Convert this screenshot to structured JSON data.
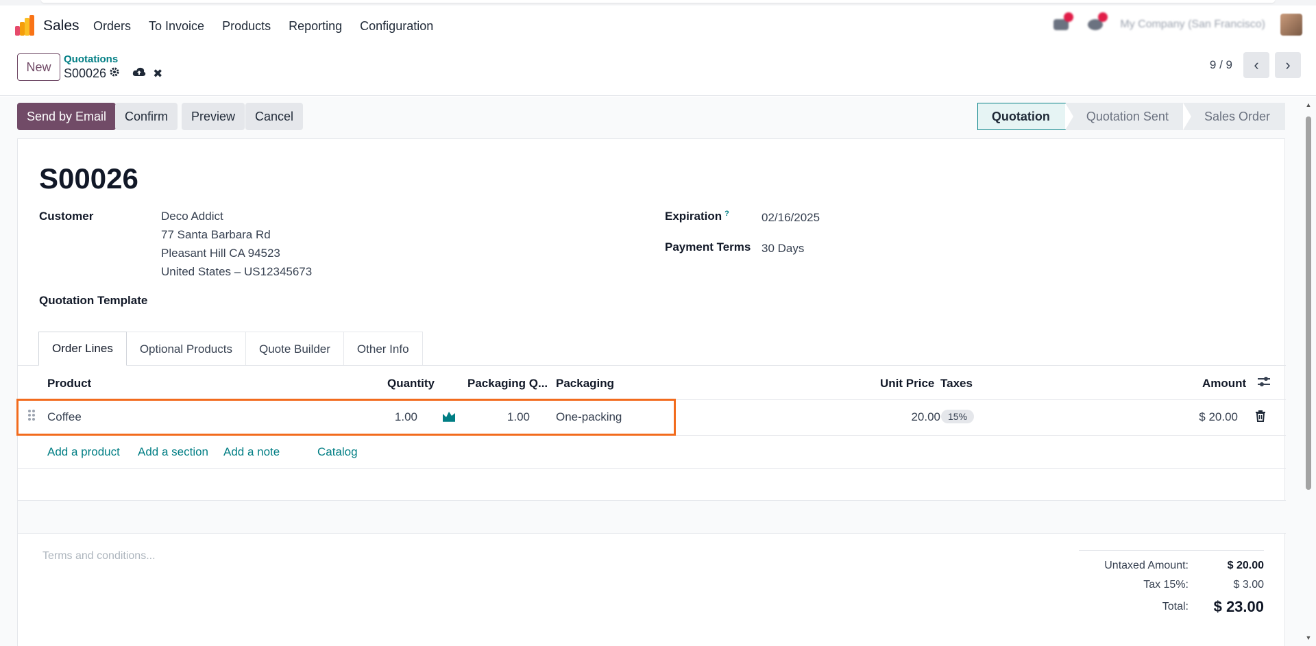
{
  "app": {
    "name": "Sales"
  },
  "nav": {
    "items": [
      "Orders",
      "To Invoice",
      "Products",
      "Reporting",
      "Configuration"
    ]
  },
  "systray": {
    "company": "My Company (San Francisco)"
  },
  "control": {
    "new_label": "New",
    "breadcrumb": "Quotations",
    "record": "S00026",
    "pager": "9 / 9"
  },
  "actions": {
    "send_email": "Send by Email",
    "confirm": "Confirm",
    "preview": "Preview",
    "cancel": "Cancel"
  },
  "status": {
    "steps": [
      "Quotation",
      "Quotation Sent",
      "Sales Order"
    ],
    "active": "Quotation"
  },
  "form": {
    "title": "S00026",
    "customer_label": "Customer",
    "customer_name": "Deco Addict",
    "customer_address1": "77 Santa Barbara Rd",
    "customer_address2": "Pleasant Hill CA 94523",
    "customer_address3": "United States – US12345673",
    "expiration_label": "Expiration",
    "expiration_help": "?",
    "expiration_value": "02/16/2025",
    "payment_terms_label": "Payment Terms",
    "payment_terms_value": "30 Days",
    "template_label": "Quotation Template"
  },
  "tabs": [
    "Order Lines",
    "Optional Products",
    "Quote Builder",
    "Other Info"
  ],
  "table": {
    "headers": {
      "product": "Product",
      "quantity": "Quantity",
      "packaging_qty": "Packaging Q...",
      "packaging": "Packaging",
      "unit_price": "Unit Price",
      "taxes": "Taxes",
      "amount": "Amount"
    },
    "rows": [
      {
        "product": "Coffee",
        "quantity": "1.00",
        "packaging_qty": "1.00",
        "packaging": "One-packing",
        "unit_price": "20.00",
        "taxes": "15%",
        "amount": "$ 20.00"
      }
    ],
    "add_links": {
      "product": "Add a product",
      "section": "Add a section",
      "note": "Add a note",
      "catalog": "Catalog"
    }
  },
  "terms_placeholder": "Terms and conditions...",
  "totals": {
    "untaxed_label": "Untaxed Amount:",
    "untaxed_value": "$ 20.00",
    "tax_label": "Tax 15%:",
    "tax_value": "$ 3.00",
    "total_label": "Total:",
    "total_value": "$ 23.00"
  },
  "colors": {
    "brand": "#714b67",
    "accent": "#017e84",
    "highlight": "#f26b1d"
  }
}
